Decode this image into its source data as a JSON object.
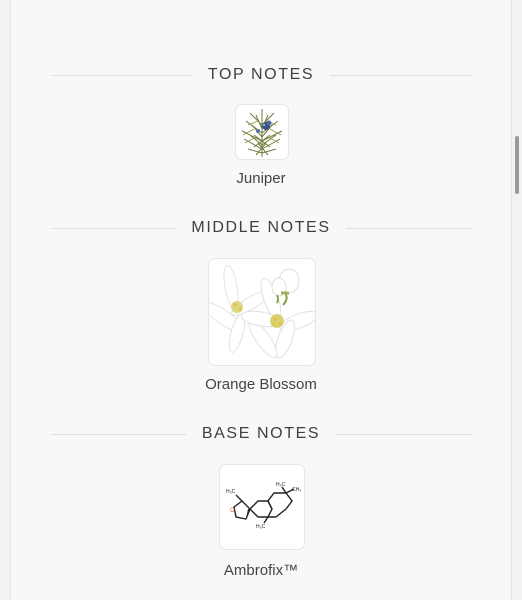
{
  "sections": [
    {
      "title": "TOP NOTES",
      "notes": [
        {
          "name": "Juniper",
          "image": "juniper-branch-image"
        }
      ]
    },
    {
      "title": "MIDDLE NOTES",
      "notes": [
        {
          "name": "Orange Blossom",
          "image": "orange-blossom-image"
        }
      ]
    },
    {
      "title": "BASE NOTES",
      "notes": [
        {
          "name": "Ambrofix™",
          "image": "ambrofix-molecule-image"
        }
      ]
    }
  ],
  "molecule_labels": {
    "h3c_left": "H₃C",
    "h3c_top": "H₃C",
    "ch3_right": "CH₃",
    "h3c_bottom": "H₃C",
    "oxygen": "O"
  },
  "colors": {
    "heading_text": "#3f3f3f",
    "label_text": "#444444",
    "divider": "#dedede",
    "card_border": "#e6e6e6"
  }
}
